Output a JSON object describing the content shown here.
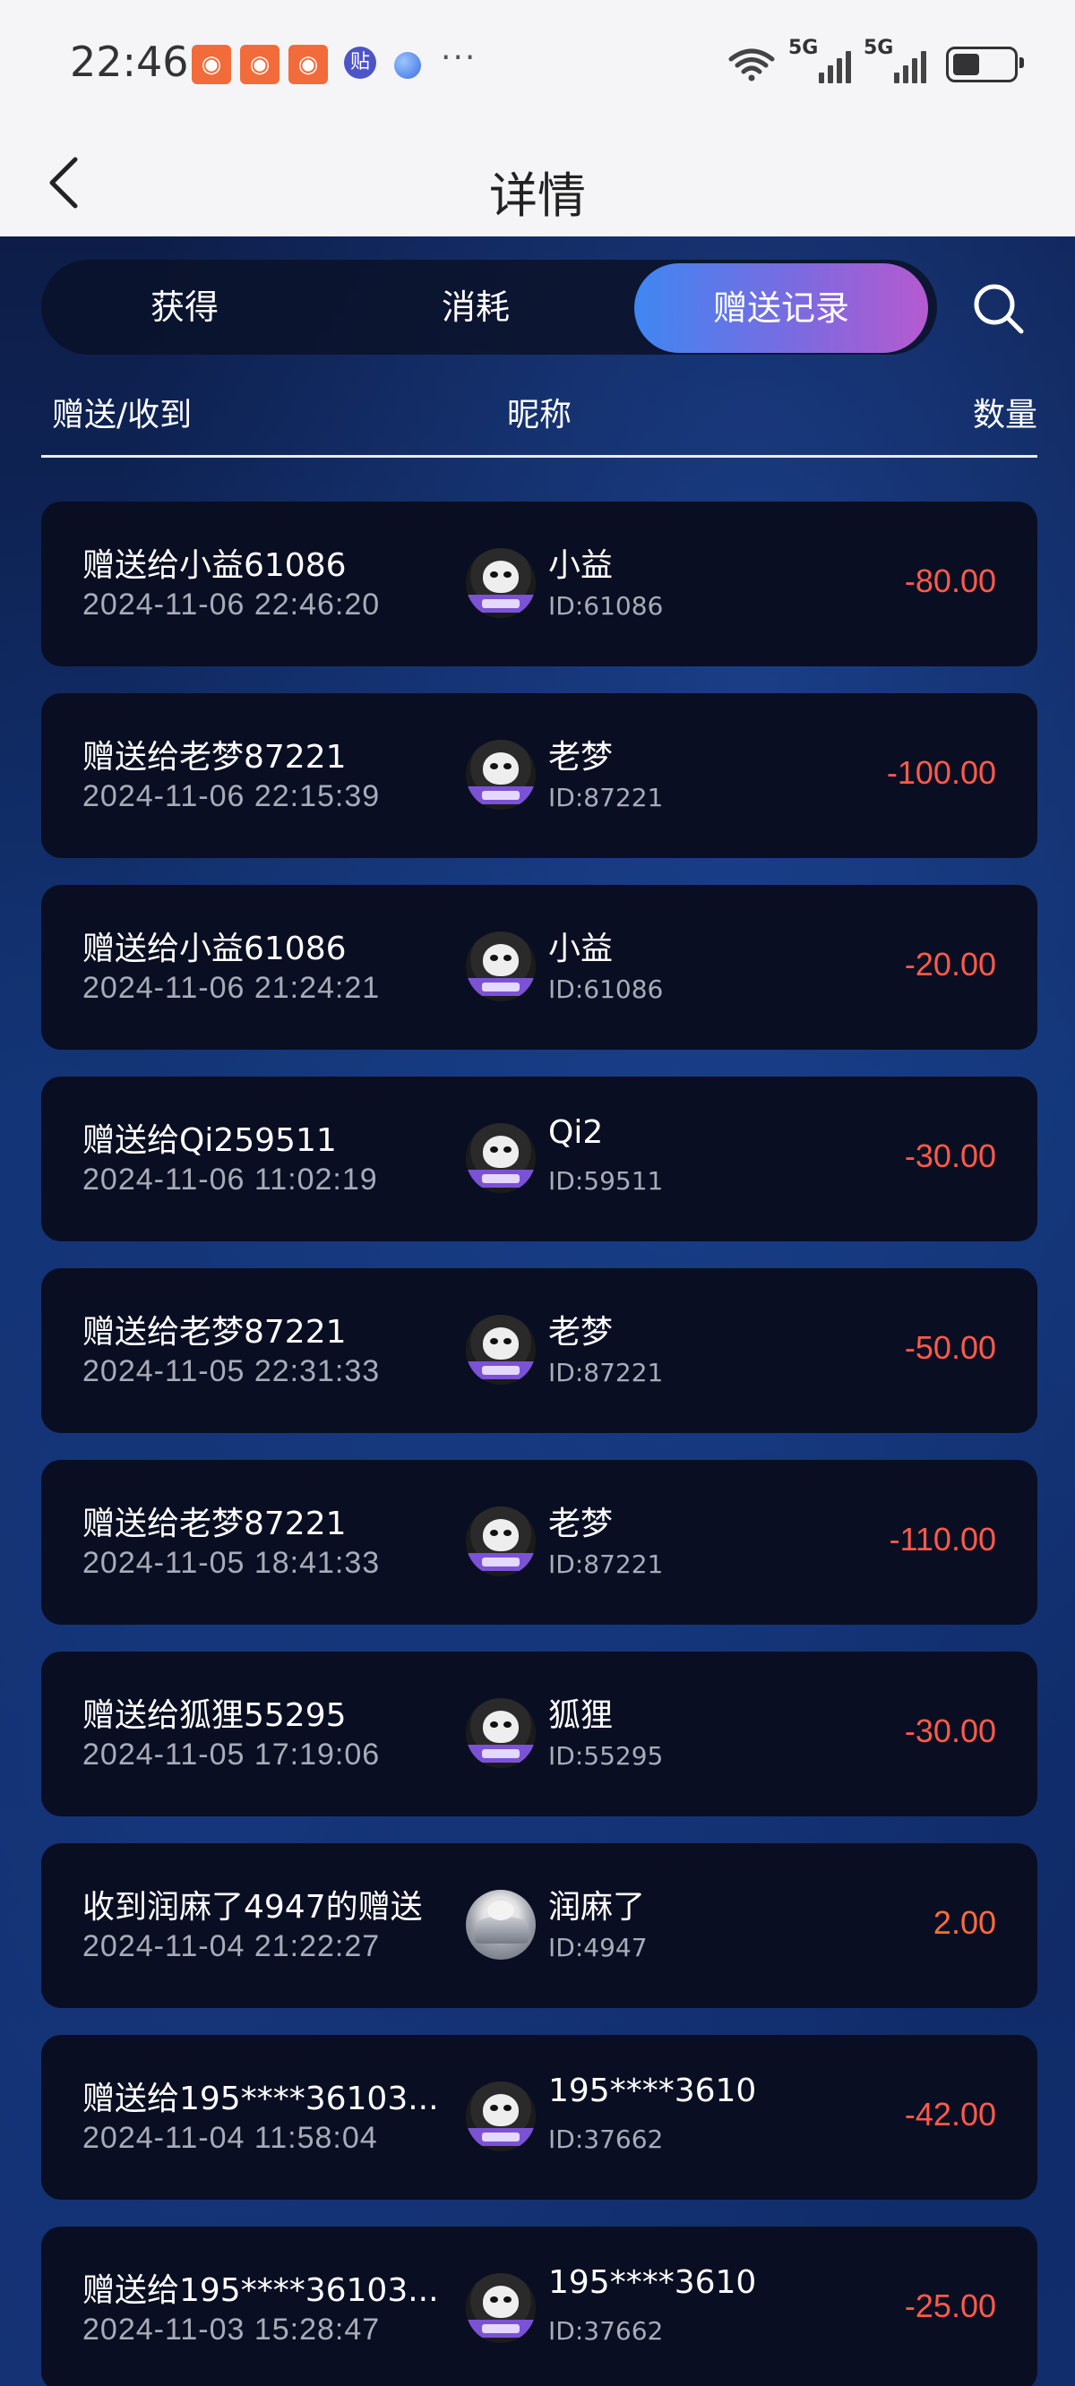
{
  "status_bar": {
    "time": "22:46",
    "app_badge": "贴",
    "more": "···",
    "signal1": "5G",
    "signal2": "5G",
    "battery_level": 0.45
  },
  "header": {
    "title": "详情"
  },
  "tabs": [
    {
      "label": "获得",
      "active": false
    },
    {
      "label": "消耗",
      "active": false
    },
    {
      "label": "赠送记录",
      "active": true
    }
  ],
  "columns": {
    "type": "赠送/收到",
    "nickname": "昵称",
    "amount": "数量"
  },
  "records": [
    {
      "title": "赠送给小益61086",
      "time": "2024-11-06 22:46:20",
      "nickname": "小益",
      "id": "ID:61086",
      "amount": "-80.00",
      "avatar": "monkey"
    },
    {
      "title": "赠送给老梦87221",
      "time": "2024-11-06 22:15:39",
      "nickname": "老梦",
      "id": "ID:87221",
      "amount": "-100.00",
      "avatar": "monkey"
    },
    {
      "title": "赠送给小益61086",
      "time": "2024-11-06 21:24:21",
      "nickname": "小益",
      "id": "ID:61086",
      "amount": "-20.00",
      "avatar": "monkey"
    },
    {
      "title": "赠送给Qi259511",
      "time": "2024-11-06 11:02:19",
      "nickname": "Qi2",
      "id": "ID:59511",
      "amount": "-30.00",
      "avatar": "monkey"
    },
    {
      "title": "赠送给老梦87221",
      "time": "2024-11-05 22:31:33",
      "nickname": "老梦",
      "id": "ID:87221",
      "amount": "-50.00",
      "avatar": "monkey"
    },
    {
      "title": "赠送给老梦87221",
      "time": "2024-11-05 18:41:33",
      "nickname": "老梦",
      "id": "ID:87221",
      "amount": "-110.00",
      "avatar": "monkey"
    },
    {
      "title": "赠送给狐狸55295",
      "time": "2024-11-05 17:19:06",
      "nickname": "狐狸",
      "id": "ID:55295",
      "amount": "-30.00",
      "avatar": "monkey"
    },
    {
      "title": "收到润麻了4947的赠送",
      "time": "2024-11-04 21:22:27",
      "nickname": "润麻了",
      "id": "ID:4947",
      "amount": "2.00",
      "avatar": "photo"
    },
    {
      "title": "赠送给195****36103...",
      "time": "2024-11-04 11:58:04",
      "nickname": "195****3610",
      "id": "ID:37662",
      "amount": "-42.00",
      "avatar": "monkey"
    },
    {
      "title": "赠送给195****36103...",
      "time": "2024-11-03 15:28:47",
      "nickname": "195****3610",
      "id": "ID:37662",
      "amount": "-25.00",
      "avatar": "monkey"
    }
  ],
  "icons": {
    "back": "chevron-left-icon",
    "search": "search-icon",
    "wifi": "wifi-icon",
    "battery": "battery-icon"
  }
}
